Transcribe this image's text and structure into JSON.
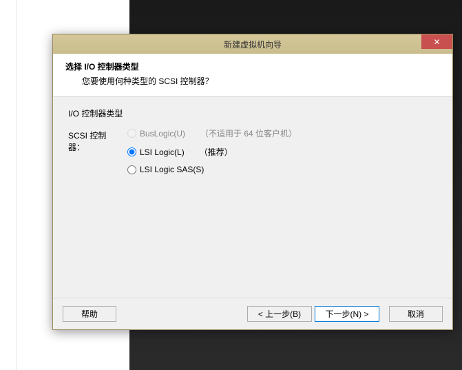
{
  "dialog": {
    "title": "新建虚拟机向导",
    "close_symbol": "✕",
    "header": {
      "title": "选择 I/O 控制器类型",
      "subtitle": "您要使用何种类型的 SCSI 控制器？"
    },
    "group_label": "I/O 控制器类型",
    "scsi_label": "SCSI 控制器：",
    "options": {
      "buslogic": {
        "label": "BusLogic(U)",
        "note": "（不适用于 64 位客户机）"
      },
      "lsilogic": {
        "label": "LSI Logic(L)",
        "note": "（推荐）"
      },
      "lsisas": {
        "label": "LSI Logic SAS(S)"
      }
    },
    "buttons": {
      "help": "帮助",
      "back": "< 上一步(B)",
      "next": "下一步(N) >",
      "cancel": "取消"
    }
  }
}
